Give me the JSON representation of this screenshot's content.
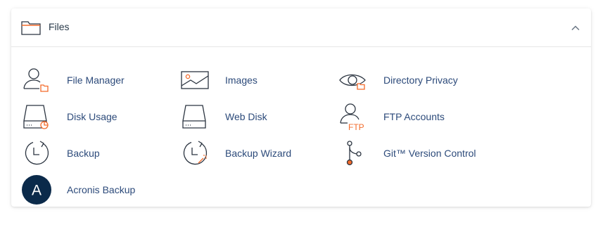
{
  "panel": {
    "title": "Files",
    "header_icon": "folder-icon",
    "toggle_icon": "chevron-up-icon"
  },
  "colors": {
    "link": "#2c4a7a",
    "icon_stroke": "#2b3440",
    "accent": "#f36b2b",
    "acronis": "#0b2a4a"
  },
  "items": [
    {
      "label": "File Manager",
      "icon": "file-manager-icon"
    },
    {
      "label": "Images",
      "icon": "images-icon"
    },
    {
      "label": "Directory Privacy",
      "icon": "directory-privacy-icon"
    },
    {
      "label": "Disk Usage",
      "icon": "disk-usage-icon"
    },
    {
      "label": "Web Disk",
      "icon": "web-disk-icon"
    },
    {
      "label": "FTP Accounts",
      "icon": "ftp-accounts-icon"
    },
    {
      "label": "Backup",
      "icon": "backup-icon"
    },
    {
      "label": "Backup Wizard",
      "icon": "backup-wizard-icon"
    },
    {
      "label": "Git™ Version Control",
      "icon": "git-version-control-icon"
    },
    {
      "label": "Acronis Backup",
      "icon": "acronis-icon",
      "icon_glyph": "A"
    }
  ]
}
